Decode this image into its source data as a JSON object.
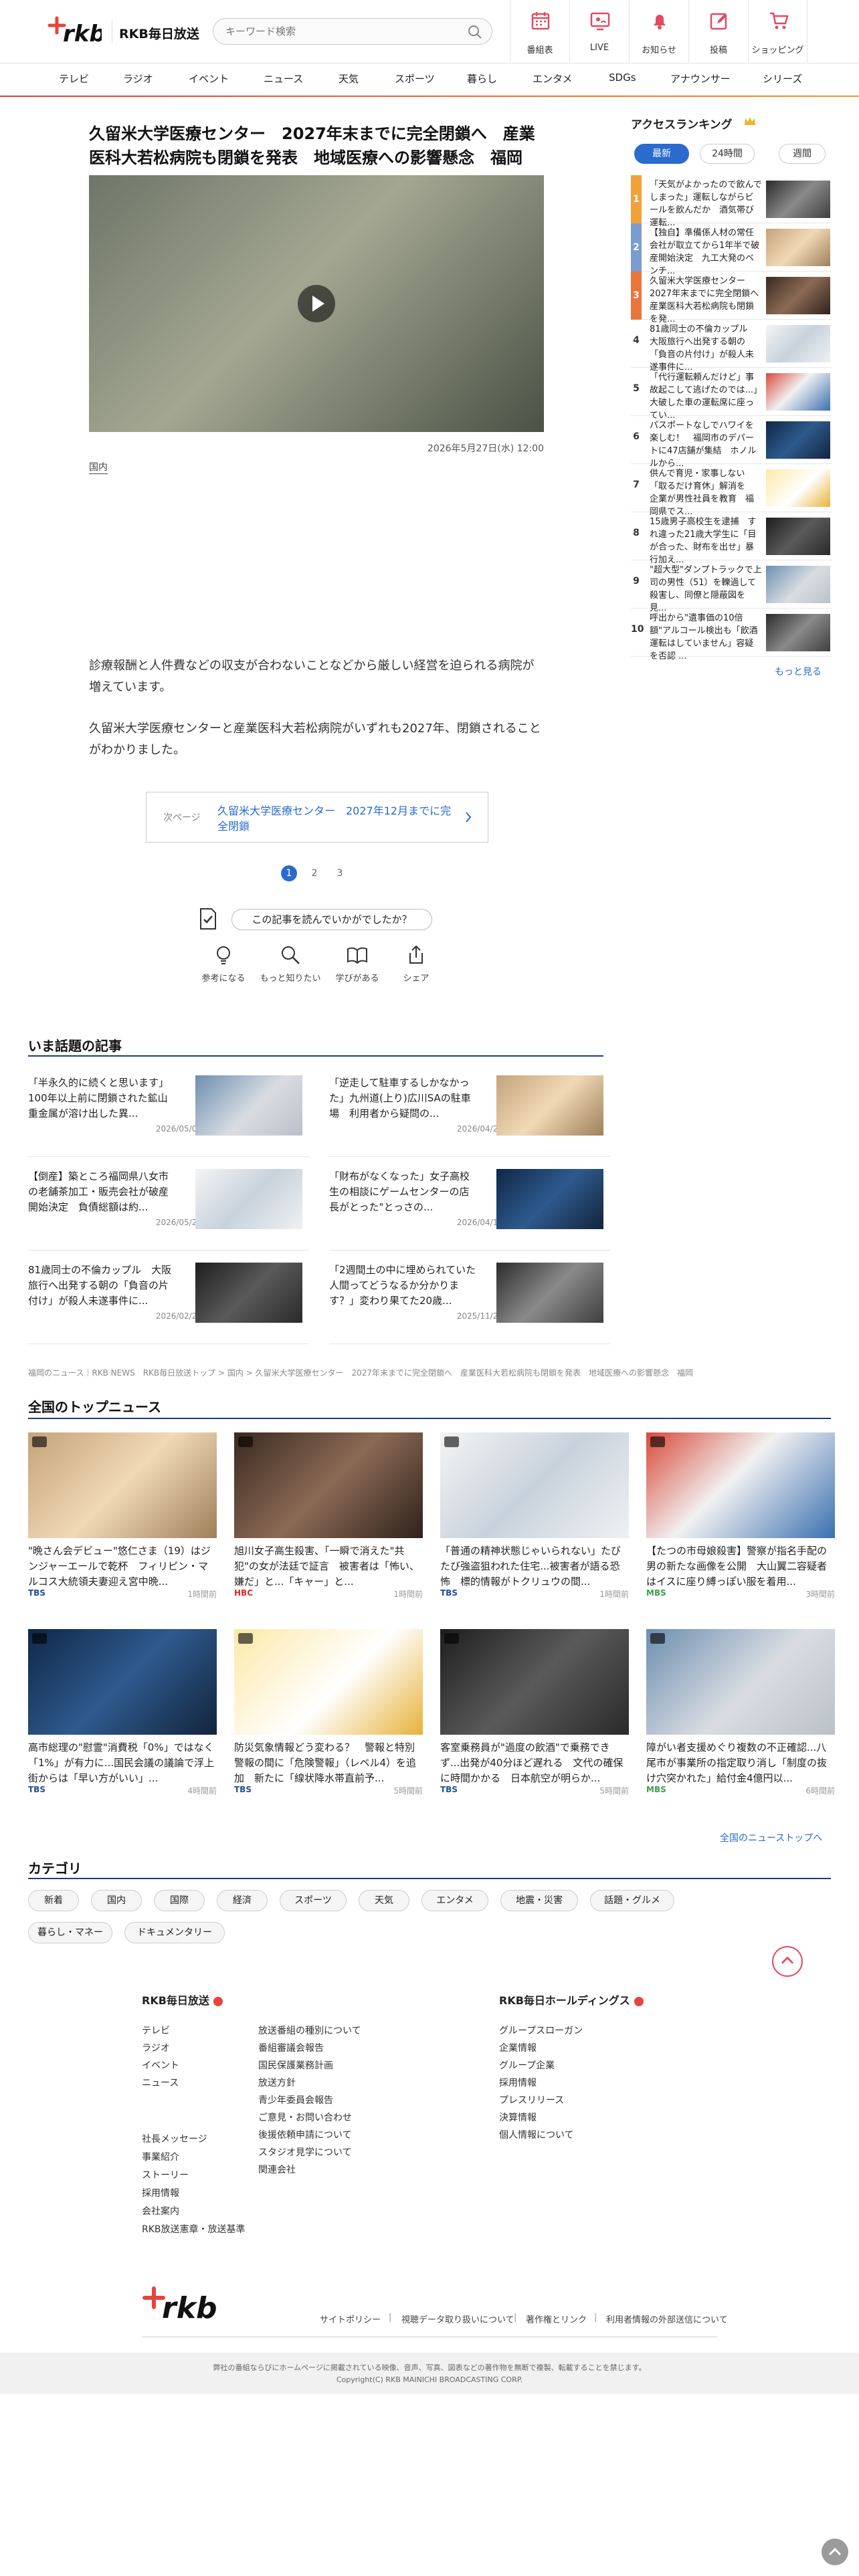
{
  "header": {
    "brand": "RKB毎日放送",
    "search_placeholder": "キーワード検索",
    "nav": [
      "番組表",
      "LIVE",
      "お知らせ",
      "投稿",
      "ショッピング"
    ]
  },
  "categories": [
    "テレビ",
    "ラジオ",
    "イベント",
    "ニュース",
    "天気",
    "スポーツ",
    "暮らし",
    "エンタメ",
    "SDGs",
    "アナウンサー",
    "シリーズ"
  ],
  "article": {
    "title": "久留米大学医療センター　2027年末までに完全閉鎖へ　産業医科大若松病院も閉鎖を発表　地域医療への影響懸念　福岡",
    "date": "2026年5月27日(水) 12:00",
    "tag": "国内",
    "paragraphs": [
      "診療報酬と人件費などの収支が合わないことなどから厳しい経営を迫られる病院が増えています。",
      "久留米大学医療センターと産業医科大若松病院がいずれも2027年、閉鎖されることがわかりました。"
    ],
    "next_label": "次ページ",
    "next_title": "久留米大学医療センター　2027年12月までに完全閉鎖",
    "pages": [
      "1",
      "2",
      "3"
    ],
    "feedback": "この記事を読んでいかがでしたか？",
    "reactions": [
      "参考になる",
      "もっと知りたい",
      "学びがある",
      "シェア"
    ]
  },
  "ranking": {
    "title": "アクセスランキング",
    "tabs": [
      "最新",
      "24時間",
      "週間"
    ],
    "items": [
      {
        "rank": "1",
        "text": "「天気がよかったので飲んでしまった」運転しながらビールを飲んだか　酒気帯び運転..."
      },
      {
        "rank": "2",
        "text": "【独自】準備係人材の常任会社が取立てから1年半で破産開始決定　九工大発のベンチ..."
      },
      {
        "rank": "3",
        "text": "久留米大学医療センター　2027年末までに完全閉鎖へ　産業医科大若松病院も閉鎖を発..."
      },
      {
        "rank": "4",
        "text": "81歳同士の不倫カップル　大阪旅行へ出発する朝の「負音の片付け」が殺人未遂事件に..."
      },
      {
        "rank": "5",
        "text": "「代行運転頼んだけど」事故起こして逃げたのでは...」大破した車の運転席に座ってい..."
      },
      {
        "rank": "6",
        "text": "パスポートなしでハワイを楽しむ！　福岡市のデパートに47店舗が集結　ホノルルから..."
      },
      {
        "rank": "7",
        "text": "供んで育児・家事しない「取るだけ育休」解消を　企業が男性社員を教育　福岡県でス..."
      },
      {
        "rank": "8",
        "text": "15歳男子高校生を逮捕　すれ違った21歳大学生に「目が合った、財布を出せ」暴行加え..."
      },
      {
        "rank": "9",
        "text": "\"超大型\"ダンプトラックで上司の男性（51）を轢過して殺害し、同僚と隠蔽図を見..."
      },
      {
        "rank": "10",
        "text": "呼出から\"遺事価の10倍額\"アルコール検出も「飲酒運転はしていません」容疑を否認 ..."
      }
    ],
    "more": "もっと見る"
  },
  "ima": {
    "title": "いま話題の記事",
    "items": [
      {
        "text": "「半永久的に続くと思います」100年以上前に閉鎖された鉱山　重金属が溶け出した異...",
        "date": "2026/05/06"
      },
      {
        "text": "「逆走して駐車するしかなかった」九州道(上り)広川SAの駐車場　利用者から疑問の...",
        "date": "2026/04/29"
      },
      {
        "text": "【倒産】築ところ福岡県八女市の老舗茶加工・販売会社が破産開始決定　負債総額は約...",
        "date": "2026/05/26"
      },
      {
        "text": "「財布がなくなった」女子高校生の相談にゲームセンターの店長がとった\"とっさの...",
        "date": "2026/04/12"
      },
      {
        "text": "81歳同士の不倫カップル　大阪旅行へ出発する朝の「負音の片付け」が殺人未遂事件に...",
        "date": "2026/02/21"
      },
      {
        "text": "「2週間土の中に埋められていた人間ってどうなるか分かります？」変わり果てた20歳...",
        "date": "2025/11/21"
      }
    ]
  },
  "breadcrumb": "福岡のニュース｜RKB NEWS　RKB毎日放送トップ > 国内 > 久留米大学医療センター　2027年末までに完全閉鎖へ　産業医科大若松病院も閉鎖を発表　地域医療への影響懸念　福岡",
  "topnews": {
    "title": "全国のトップニュース",
    "items": [
      {
        "text": "\"晩さん会デビュー\"悠仁さま（19）はジンジャーエールで乾杯　フィリピン・マルコス大統領夫妻迎え宮中晩...",
        "src": "TBS",
        "time": "1時間前",
        "src_color": "#1f4ea0"
      },
      {
        "text": "旭川女子高生殺害、「一瞬で消えた\"共犯\"の女が法廷で証言　被害者は「怖い、嫌だ」と...「キャー」と...",
        "src": "HBC",
        "time": "1時間前",
        "src_color": "#d42b2b"
      },
      {
        "text": "「普通の精神状態じゃいられない」たびたび強盗狙われた住宅...被害者が語る恐怖　標的情報がトクリュウの間...",
        "src": "TBS",
        "time": "1時間前",
        "src_color": "#1f4ea0"
      },
      {
        "text": "【たつの市母娘殺害】警察が指名手配の男の新たな画像を公開　大山翼二容疑者はイスに座り縛っぽい服を着用...",
        "src": "MBS",
        "time": "3時間前",
        "src_color": "#3aa14a"
      },
      {
        "text": "高市総理の\"慰霊\"消費税「0%」ではなく「1%」が有力に...国民会議の議論で浮上　街からは「早い方がいい」...",
        "src": "TBS",
        "time": "4時間前",
        "src_color": "#1f4ea0"
      },
      {
        "text": "防災気象情報どう変わる？　警報と特別警報の間に「危険警報」（レベル4）を追加　新たに「線状降水帯直前予...",
        "src": "TBS",
        "time": "5時間前",
        "src_color": "#1f4ea0"
      },
      {
        "text": "客室乗務員が\"過度の飲酒\"で乗務できず...出発が40分ほど遅れる　文代の確保に時間かかる　日本航空が明らか...",
        "src": "TBS",
        "time": "5時間前",
        "src_color": "#1f4ea0"
      },
      {
        "text": "障がい者支援めぐり複数の不正確認...八尾市が事業所の指定取り消し「制度の抜け穴突かれた」給付金4億円以...",
        "src": "MBS",
        "time": "6時間前",
        "src_color": "#3aa14a"
      }
    ],
    "more": "全国のニューストップへ"
  },
  "category": {
    "title": "カテゴリ",
    "chips": [
      "新着",
      "国内",
      "国際",
      "経済",
      "スポーツ",
      "天気",
      "エンタメ",
      "地震・災害",
      "話題・グルメ",
      "暮らし・マネー",
      "ドキュメンタリー"
    ]
  },
  "footer": {
    "col1_title": "RKB毎日放送",
    "col1a": [
      "テレビ",
      "ラジオ",
      "イベント",
      "ニュース"
    ],
    "col1b": [
      "放送番組の種別について",
      "番組審議会報告",
      "国民保護業務計画",
      "放送方針",
      "青少年委員会報告",
      "ご意見・お問い合わせ",
      "後援依頼申請について",
      "スタジオ見学について",
      "関連会社"
    ],
    "col1c": [
      "社長メッセージ",
      "事業紹介",
      "ストーリー",
      "採用情報",
      "会社案内",
      "RKB放送憲章・放送基準"
    ],
    "col2_title": "RKB毎日ホールディングス",
    "col2": [
      "グループスローガン",
      "企業情報",
      "グループ企業",
      "採用情報",
      "プレスリリース",
      "決算情報",
      "個人情報について"
    ],
    "links": [
      "サイトポリシー",
      "視聴データ取り扱いについて",
      "著作権とリンク",
      "利用者情報の外部送信について"
    ],
    "notice": "弊社の番組ならびにホームページに掲載されている映像、音声、写真、図表などの著作物を無断で複製、転載することを禁じます。",
    "copyright": "Copyright(C) RKB MAINICHI BROADCASTING CORP."
  },
  "colors": {
    "accent": "#2a6bcd",
    "brand_red": "#e8433c",
    "navy": "#1f3b7a"
  }
}
